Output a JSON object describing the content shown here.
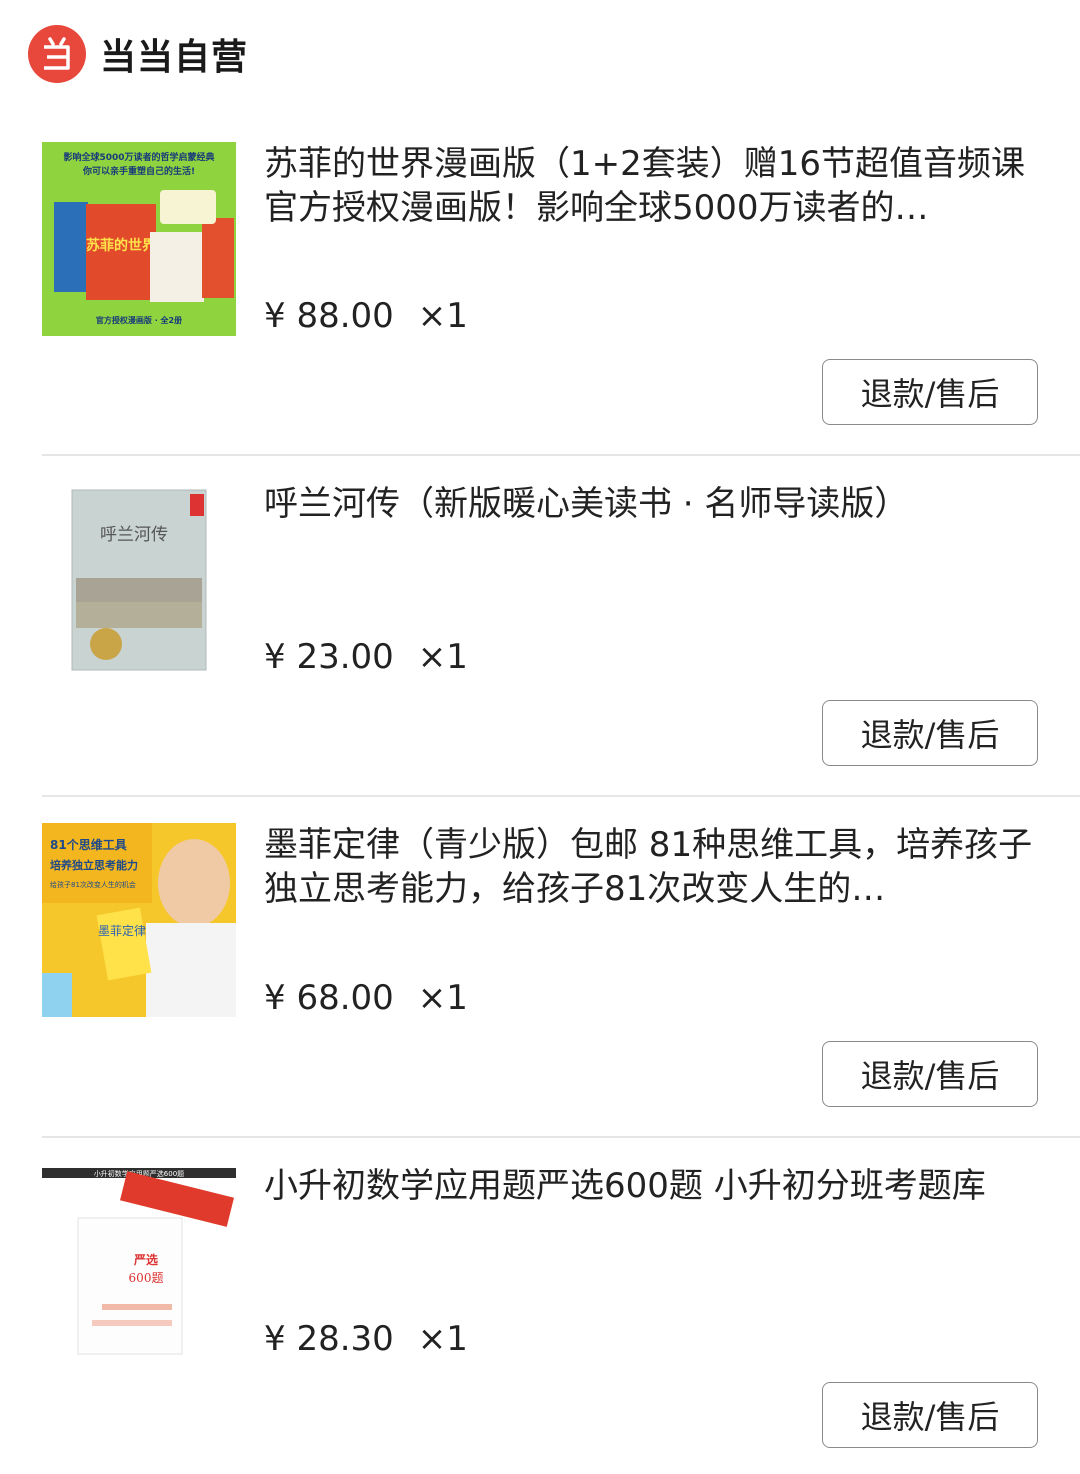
{
  "store": {
    "logo_icon": "dangdang-logo-icon",
    "name": "当当自营",
    "brand_color": "#e8473c"
  },
  "items": [
    {
      "title": "苏菲的世界漫画版（1+2套装）赠16节超值音频课 官方授权漫画版！影响全球5000万读者的…",
      "price": "¥ 88.00",
      "qty": "×1",
      "action": "退款/售后",
      "cover_lines": [
        "影响全球5000万读者的哲学启蒙经典",
        "你可以亲手重塑自己的生活!",
        "苏菲的世界",
        "官方授权漫画版 · 全2册"
      ]
    },
    {
      "title": "呼兰河传（新版暖心美读书 · 名师导读版）",
      "price": "¥ 23.00",
      "qty": "×1",
      "action": "退款/售后",
      "cover_lines": [
        "呼兰河传"
      ]
    },
    {
      "title": "墨菲定律（青少版）包邮 81种思维工具，培养孩子独立思考能力，给孩子81次改变人生的…",
      "price": "¥ 68.00",
      "qty": "×1",
      "action": "退款/售后",
      "cover_lines": [
        "81个思维工具",
        "培养独立思考能力",
        "给孩子81次改变人生的机会",
        "墨菲定律"
      ]
    },
    {
      "title": "小升初数学应用题严选600题 小升初分班考题库",
      "price": "¥ 28.30",
      "qty": "×1",
      "action": "退款/售后",
      "cover_lines": [
        "小升初数学应用题严选600题",
        "严选",
        "600题"
      ]
    }
  ]
}
